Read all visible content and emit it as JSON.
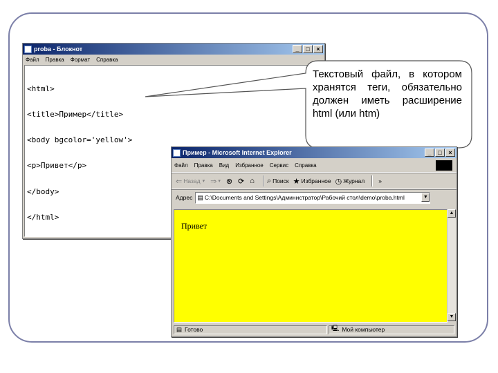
{
  "notepad": {
    "title": "proba - Блокнот",
    "menu": [
      "Файл",
      "Правка",
      "Формат",
      "Справка"
    ],
    "code_lines": [
      "<html>",
      "<title>Пример</title>",
      "<body bgcolor='yellow'>",
      "<p>Привет</p>",
      "</body>",
      "</html>"
    ]
  },
  "callout": {
    "text": "Текстовый файл, в котором хранятся теги, обязательно должен иметь расширение html (или htm)"
  },
  "ie": {
    "title": "Пример - Microsoft Internet Explorer",
    "menu": [
      "Файл",
      "Правка",
      "Вид",
      "Избранное",
      "Сервис",
      "Справка"
    ],
    "toolbar": {
      "back": "Назад",
      "search": "Поиск",
      "favorites": "Избранное",
      "journal": "Журнал"
    },
    "address_label": "Адрес",
    "address_value": "C:\\Documents and Settings\\Администратор\\Рабочий стол\\demo\\proba.html",
    "page_text": "Привет",
    "status_left": "Готово",
    "status_right": "Мой компьютер",
    "page_bg": "#ffff00"
  },
  "colors": {
    "frame": "#7b7fa8",
    "titlebar": "#0a246a"
  }
}
